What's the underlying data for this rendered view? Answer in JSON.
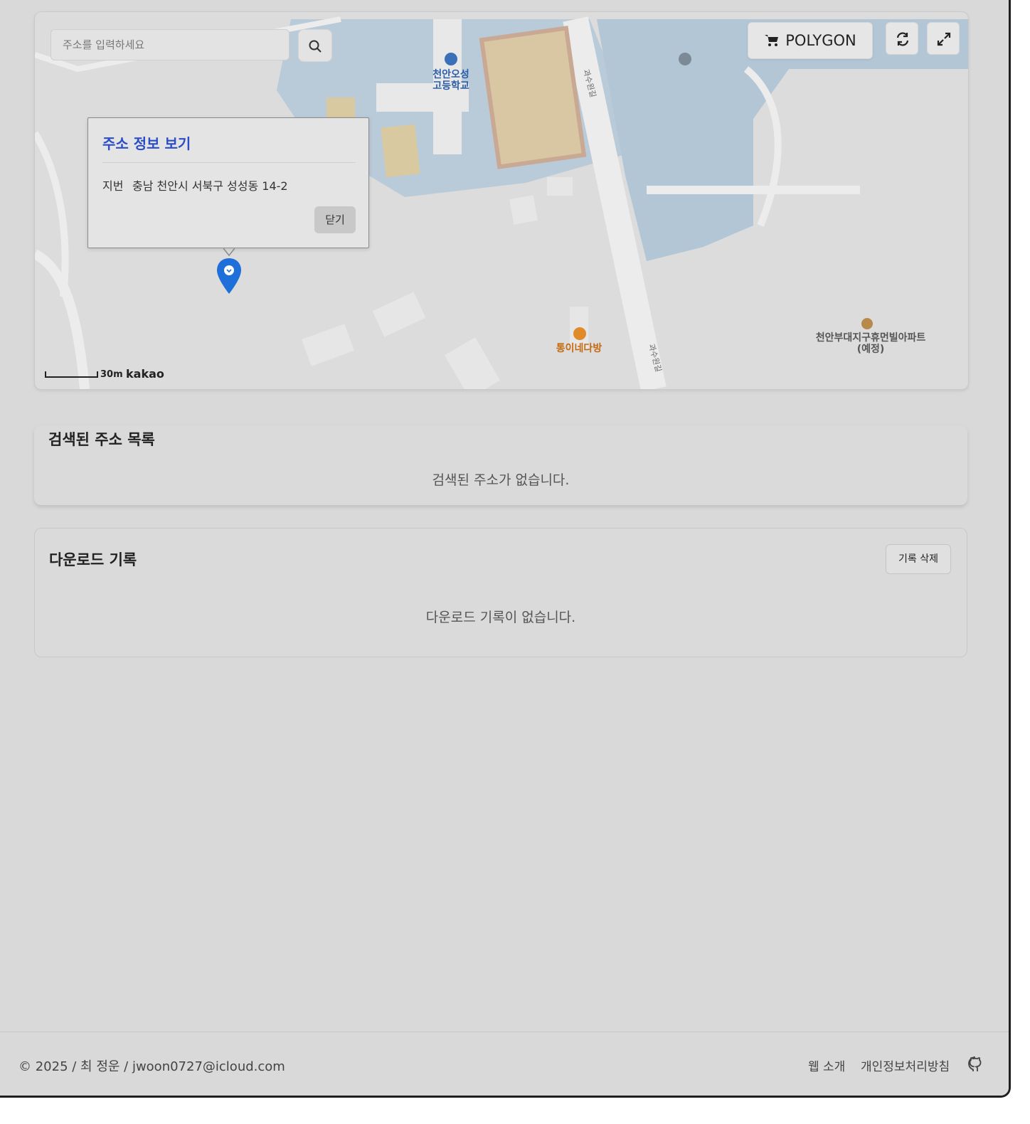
{
  "map": {
    "search_placeholder": "주소를 입력하세요",
    "polygon_label": "POLYGON",
    "labels": {
      "school": "천안오성\n고등학교",
      "cafe": "통이네다방",
      "apartment": "천안부대지구휴먼빌아파트\n(예정)",
      "road1": "과수원길",
      "road2": "과수원길"
    },
    "scale_label": "30m",
    "provider_logo": "kakao",
    "info_popup": {
      "title": "주소 정보 보기",
      "field_key": "지번",
      "field_value": "충남 천안시 서북구 성성동 14-2",
      "close_label": "닫기"
    },
    "icons": {
      "search": "search-icon",
      "cart": "cart-icon",
      "refresh": "refresh-icon",
      "fullscreen": "expand-icon",
      "marker": "map-marker-icon"
    }
  },
  "address_list": {
    "title": "검색된 주소 목록",
    "empty_message": "검색된 주소가 없습니다."
  },
  "download_history": {
    "title": "다운로드 기록",
    "clear_label": "기록 삭제",
    "empty_message": "다운로드 기록이 없습니다."
  },
  "footer": {
    "copyright": "© 2025 / 최 정운 / jwoon0727@icloud.com",
    "link_about": "웹 소개",
    "link_privacy": "개인정보처리방침",
    "github_icon": "github-icon"
  },
  "colors": {
    "accent_blue": "#2b4ec4",
    "marker_blue": "#1e6fd9",
    "cafe_orange": "#c46a10"
  }
}
